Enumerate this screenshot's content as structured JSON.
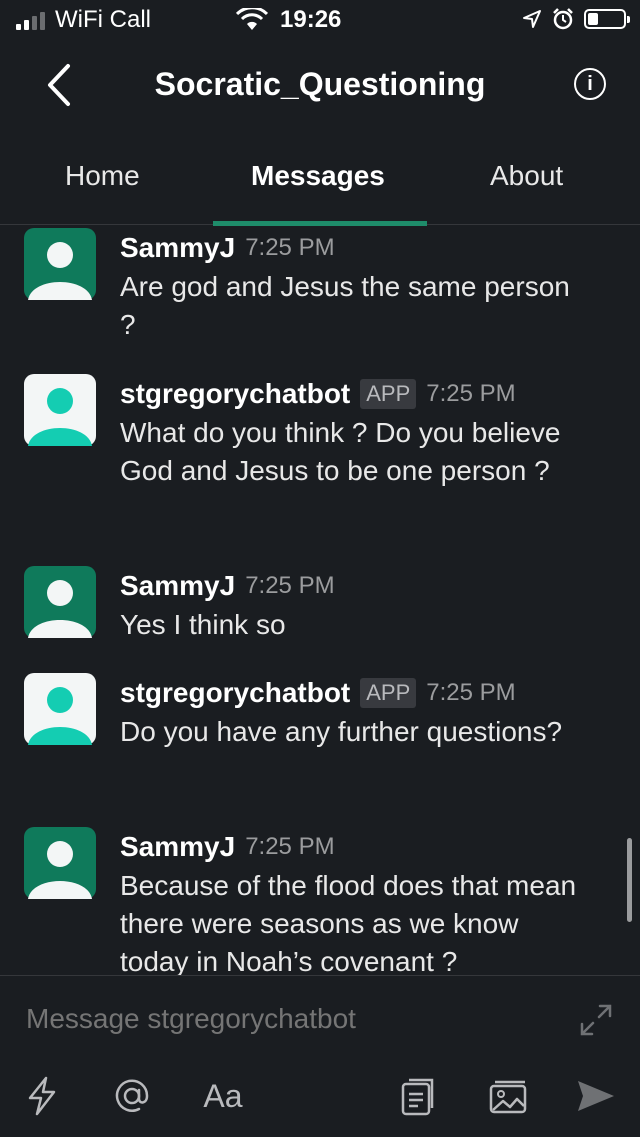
{
  "status_bar": {
    "carrier": "WiFi Call",
    "time": "19:26",
    "battery_level": 0.3
  },
  "header": {
    "title": "Socratic_Questioning"
  },
  "tabs": [
    {
      "label": "Home",
      "active": false
    },
    {
      "label": "Messages",
      "active": true
    },
    {
      "label": "About",
      "active": false
    }
  ],
  "messages": [
    {
      "author": "SammyJ",
      "is_app": false,
      "time": "7:25 PM",
      "text": "Are god and Jesus the same person ?"
    },
    {
      "author": "stgregorychatbot",
      "is_app": true,
      "app_label": "APP",
      "time": "7:25 PM",
      "text": "What do you think ? Do you believe God and Jesus to be one person ?"
    },
    {
      "author": "SammyJ",
      "is_app": false,
      "time": "7:25 PM",
      "text": "Yes I think so"
    },
    {
      "author": "stgregorychatbot",
      "is_app": true,
      "app_label": "APP",
      "time": "7:25 PM",
      "text": "Do you have any further questions?"
    },
    {
      "author": "SammyJ",
      "is_app": false,
      "time": "7:25 PM",
      "text": "Because of the flood does that mean there were seasons as we know today in Noah’s covenant ?"
    }
  ],
  "composer": {
    "placeholder": "Message stgregorychatbot"
  },
  "toolbar": {
    "format_label": "Aa"
  },
  "colors": {
    "background": "#1a1d21",
    "accent": "#1e8c6a",
    "user_avatar_bg": "#0f7a5b",
    "bot_avatar_bg": "#f3f6f6",
    "bot_avatar_figure": "#14cdb2"
  },
  "icons": [
    "signal-icon",
    "wifi-icon",
    "location-icon",
    "alarm-icon",
    "battery-icon",
    "back-chevron-icon",
    "info-icon",
    "expand-icon",
    "shortcut-bolt-icon",
    "mention-icon",
    "attach-file-icon",
    "photo-icon",
    "send-icon"
  ]
}
